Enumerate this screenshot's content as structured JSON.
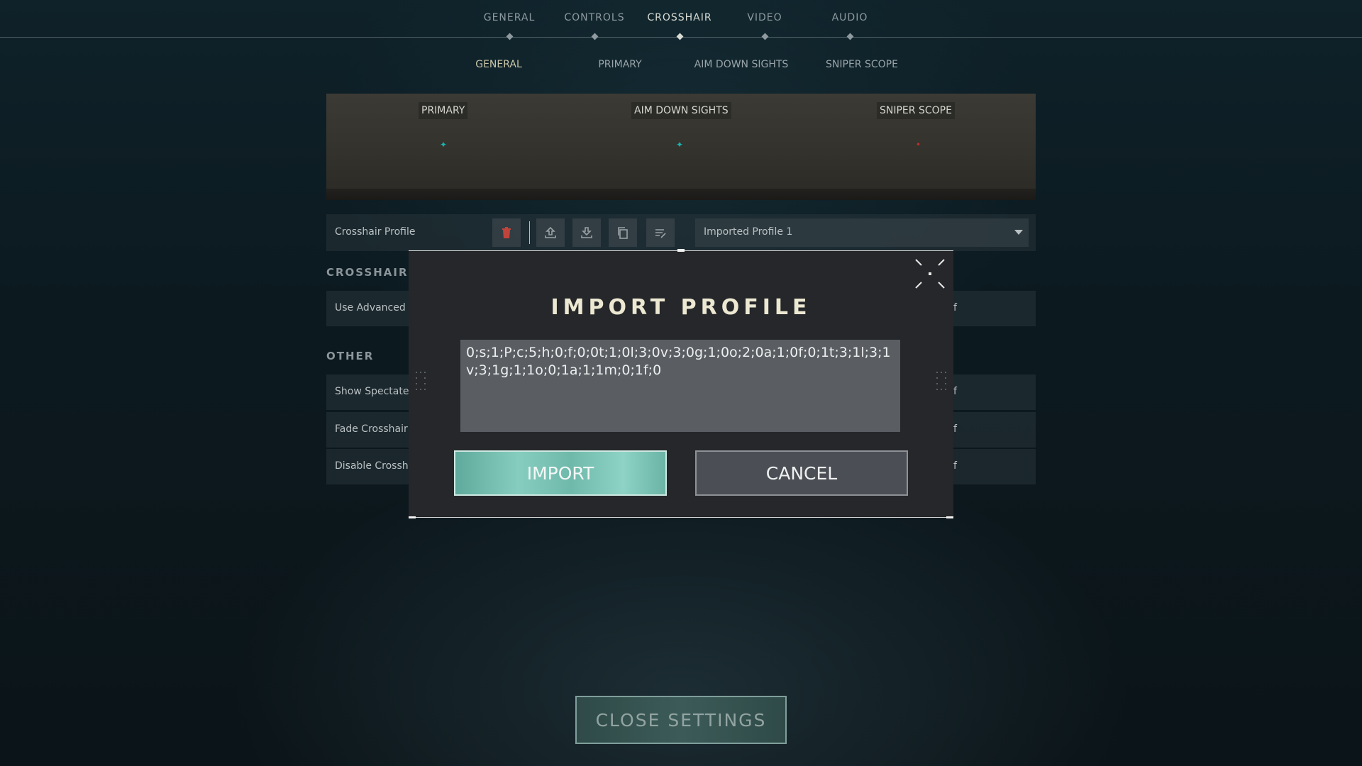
{
  "top_nav": {
    "items": [
      {
        "label": "GENERAL",
        "active": false
      },
      {
        "label": "CONTROLS",
        "active": false
      },
      {
        "label": "CROSSHAIR",
        "active": true
      },
      {
        "label": "VIDEO",
        "active": false
      },
      {
        "label": "AUDIO",
        "active": false
      }
    ]
  },
  "sub_nav": {
    "items": [
      {
        "label": "GENERAL",
        "active": true
      },
      {
        "label": "PRIMARY",
        "active": false
      },
      {
        "label": "AIM DOWN SIGHTS",
        "active": false
      },
      {
        "label": "SNIPER SCOPE",
        "active": false
      }
    ]
  },
  "preview": {
    "tags": [
      "PRIMARY",
      "AIM DOWN SIGHTS",
      "SNIPER SCOPE"
    ],
    "crosshair_colors": [
      "#19b3b0",
      "#19b3b0",
      "#c2302b"
    ]
  },
  "profile": {
    "label": "Crosshair Profile",
    "icons": [
      "trash-icon",
      "export-icon",
      "import-icon",
      "copy-icon",
      "rename-icon"
    ],
    "selected": "Imported Profile 1"
  },
  "sections": {
    "crosshair": "CROSSHAIR",
    "other": "OTHER"
  },
  "rows": {
    "advanced": {
      "label": "Use Advanced O",
      "right": "f"
    },
    "spectated": {
      "label": "Show Spectated",
      "right": "f"
    },
    "fade": {
      "label": "Fade Crosshair V",
      "right": "f"
    },
    "disable": {
      "label": "Disable Crossha",
      "right": "f"
    }
  },
  "modal": {
    "title": "IMPORT PROFILE",
    "code": "0;s;1;P;c;5;h;0;f;0;0t;1;0l;3;0v;3;0g;1;0o;2;0a;1;0f;0;1t;3;1l;3;1v;3;1g;1;1o;0;1a;1;1m;0;1f;0",
    "import_label": "IMPORT",
    "cancel_label": "CANCEL"
  },
  "footer": {
    "close_label": "CLOSE SETTINGS"
  },
  "colors": {
    "accent": "#6fb9ab",
    "modal_bg": "#25272a",
    "title": "#ece8d2"
  }
}
